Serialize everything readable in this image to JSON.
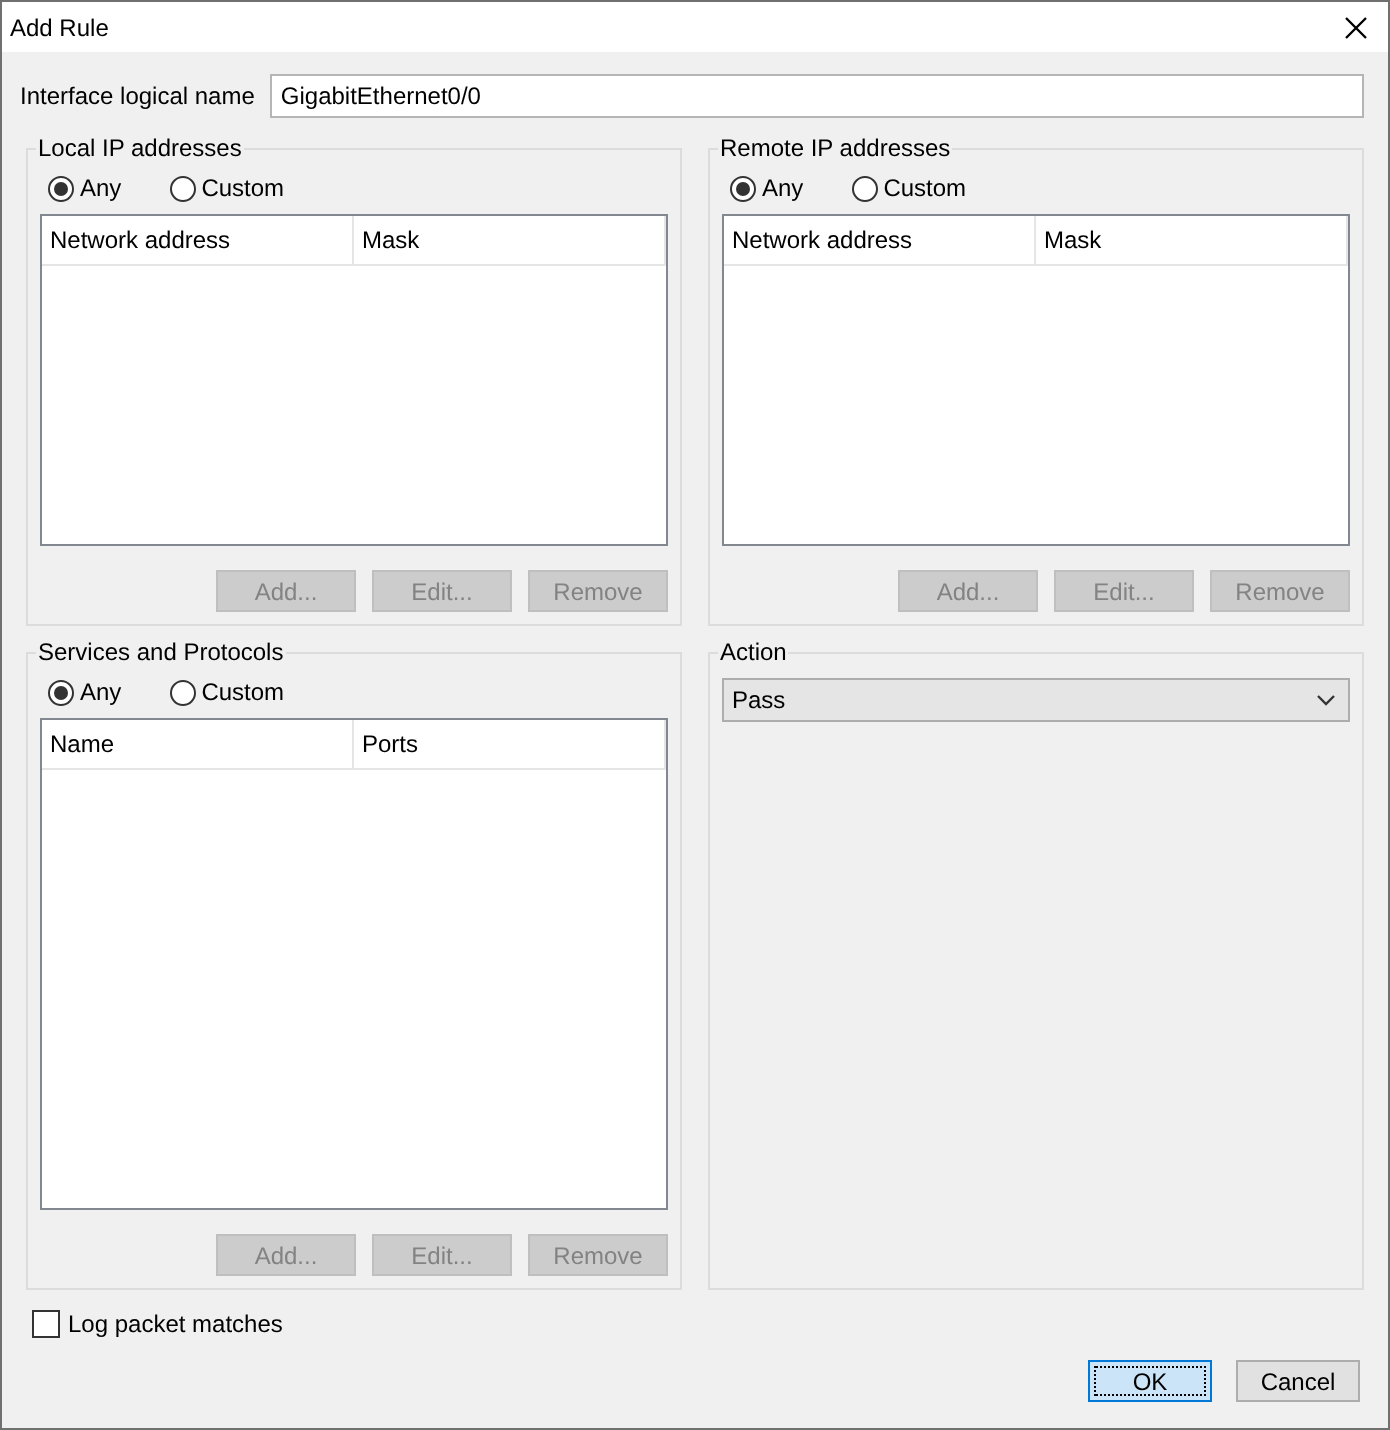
{
  "window": {
    "title": "Add Rule"
  },
  "interface": {
    "label": "Interface logical name",
    "value": "GigabitEthernet0/0"
  },
  "sections": [
    {
      "kind": "list",
      "title": "Local IP addresses",
      "options": [
        {
          "label": "Any",
          "selected": true
        },
        {
          "label": "Custom",
          "selected": false
        }
      ],
      "columns": [
        "Network address",
        "Mask"
      ],
      "buttons": [
        {
          "label": "Add...",
          "disabled": true
        },
        {
          "label": "Edit...",
          "disabled": true
        },
        {
          "label": "Remove",
          "disabled": true
        }
      ]
    },
    {
      "kind": "list",
      "title": "Remote IP addresses",
      "options": [
        {
          "label": "Any",
          "selected": true
        },
        {
          "label": "Custom",
          "selected": false
        }
      ],
      "columns": [
        "Network address",
        "Mask"
      ],
      "buttons": [
        {
          "label": "Add...",
          "disabled": true
        },
        {
          "label": "Edit...",
          "disabled": true
        },
        {
          "label": "Remove",
          "disabled": true
        }
      ]
    },
    {
      "kind": "list",
      "title": "Services and Protocols",
      "options": [
        {
          "label": "Any",
          "selected": true
        },
        {
          "label": "Custom",
          "selected": false
        }
      ],
      "columns": [
        "Name",
        "Ports"
      ],
      "buttons": [
        {
          "label": "Add...",
          "disabled": true
        },
        {
          "label": "Edit...",
          "disabled": true
        },
        {
          "label": "Remove",
          "disabled": true
        }
      ]
    },
    {
      "kind": "select",
      "title": "Action",
      "value": "Pass"
    }
  ],
  "log": {
    "label": "Log packet matches",
    "checked": false
  },
  "buttons": [
    {
      "label": "OK",
      "default": true
    },
    {
      "label": "Cancel",
      "default": false
    }
  ]
}
